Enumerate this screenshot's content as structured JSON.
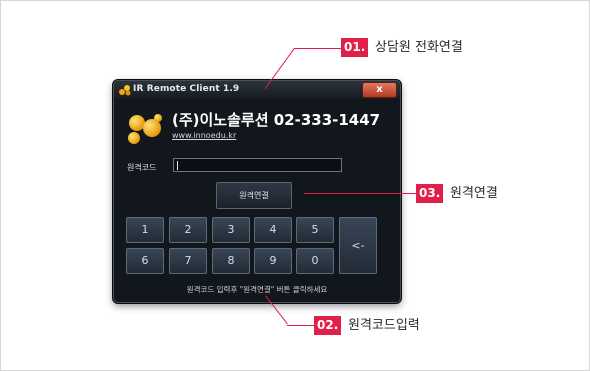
{
  "window": {
    "title": "IR Remote Client 1.9",
    "close_label": "x",
    "company": "(주)이노솔루션   02-333-1447",
    "website": "www.innoedu.kr",
    "code_label": "원격코드",
    "code_value": "",
    "connect_label": "원격연결",
    "keypad_row1": [
      "1",
      "2",
      "3",
      "4",
      "5"
    ],
    "keypad_row2": [
      "6",
      "7",
      "8",
      "9",
      "0"
    ],
    "backspace_label": "<-",
    "hint": "원격코드 입력후 \"원격연결\" 버튼 클릭하세요"
  },
  "callouts": [
    {
      "number": "01.",
      "label": "상담원 전화연결"
    },
    {
      "number": "02.",
      "label": "원격코드입력"
    },
    {
      "number": "03.",
      "label": "원격연결"
    }
  ],
  "colors": {
    "accent": "#e0204a",
    "window_bg": "#12171e",
    "logo": "#f2a800"
  }
}
